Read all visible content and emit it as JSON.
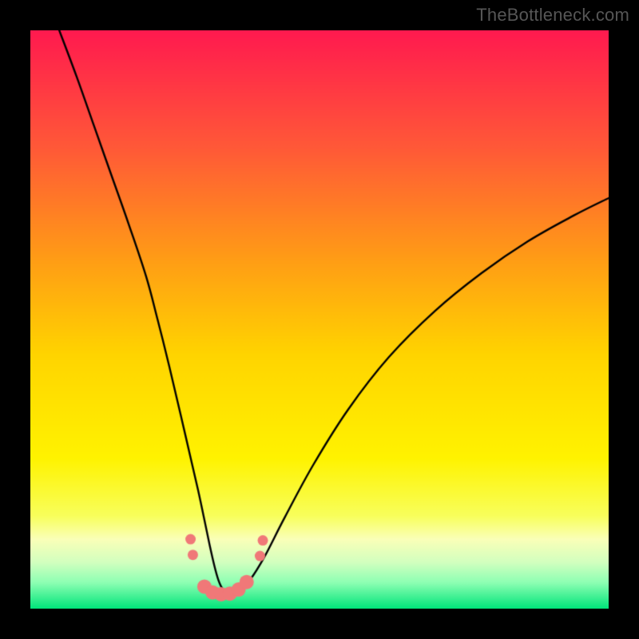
{
  "watermark": "TheBottleneck.com",
  "chart_data": {
    "type": "line",
    "title": "",
    "xlabel": "",
    "ylabel": "",
    "xlim": [
      0,
      100
    ],
    "ylim": [
      0,
      100
    ],
    "grid": false,
    "gradient": {
      "stops": [
        {
          "pos": 0.0,
          "color": "#ff1a4f"
        },
        {
          "pos": 0.2,
          "color": "#ff5838"
        },
        {
          "pos": 0.4,
          "color": "#ff9e15"
        },
        {
          "pos": 0.56,
          "color": "#ffd400"
        },
        {
          "pos": 0.74,
          "color": "#fff300"
        },
        {
          "pos": 0.84,
          "color": "#f8ff5c"
        },
        {
          "pos": 0.88,
          "color": "#faffb8"
        },
        {
          "pos": 0.92,
          "color": "#d2ffbf"
        },
        {
          "pos": 0.955,
          "color": "#8dffb3"
        },
        {
          "pos": 1.0,
          "color": "#00e47a"
        }
      ]
    },
    "series": [
      {
        "name": "bottleneck-curve",
        "color": "#000000",
        "width": 2.4,
        "x": [
          5,
          8,
          11,
          14,
          17,
          20,
          22,
          24,
          26,
          27.5,
          29,
          30,
          31,
          31.8,
          32.5,
          33.2,
          34,
          35,
          36.3,
          38,
          40.5,
          44,
          49,
          55,
          62,
          70,
          78,
          86,
          94,
          100
        ],
        "y": [
          100,
          92,
          83.5,
          75,
          66.5,
          57.5,
          50,
          42,
          33.5,
          27,
          20.5,
          15.8,
          11,
          7.5,
          5,
          3.5,
          3,
          3,
          3.4,
          5,
          9,
          15.8,
          25,
          34.5,
          43.5,
          51.5,
          58,
          63.5,
          68,
          71
        ]
      }
    ],
    "markers": {
      "color": "#f07878",
      "radius_major": 9,
      "radius_minor": 6.5,
      "points": [
        {
          "x": 27.7,
          "y": 12.0,
          "r": "minor"
        },
        {
          "x": 28.1,
          "y": 9.3,
          "r": "minor"
        },
        {
          "x": 30.1,
          "y": 3.8,
          "r": "major"
        },
        {
          "x": 31.5,
          "y": 2.8,
          "r": "major"
        },
        {
          "x": 33.0,
          "y": 2.5,
          "r": "major"
        },
        {
          "x": 34.5,
          "y": 2.6,
          "r": "major"
        },
        {
          "x": 36.0,
          "y": 3.3,
          "r": "major"
        },
        {
          "x": 37.4,
          "y": 4.6,
          "r": "major"
        },
        {
          "x": 39.7,
          "y": 9.1,
          "r": "minor"
        },
        {
          "x": 40.2,
          "y": 11.8,
          "r": "minor"
        }
      ]
    }
  }
}
